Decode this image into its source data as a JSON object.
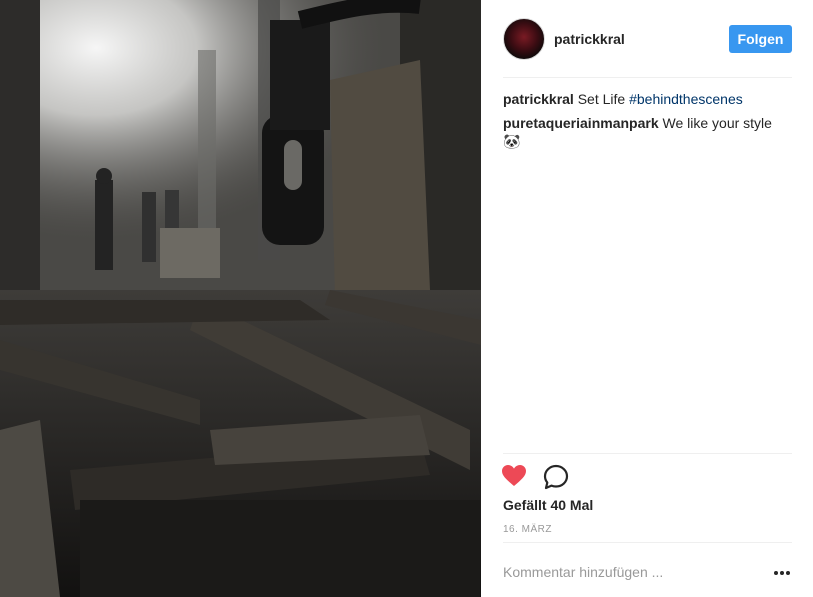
{
  "post": {
    "username": "patrickkral",
    "follow_label": "Folgen",
    "caption": {
      "user": "patrickkral",
      "text": "Set Life ",
      "hashtag": "#behindthescenes"
    },
    "comments": [
      {
        "user": "puretaqueriainmanpark",
        "text": "We like your style 🐼"
      }
    ],
    "likes_text": "Gefällt 40 Mal",
    "date": "16. MÄRZ",
    "add_comment_placeholder": "Kommentar hinzufügen ...",
    "liked": true
  },
  "icons": {
    "like": "heart-icon",
    "comment": "comment-icon",
    "more": "more-options-icon"
  },
  "colors": {
    "follow_button": "#3897f0",
    "heart": "#ed4956",
    "hashtag": "#003569"
  }
}
